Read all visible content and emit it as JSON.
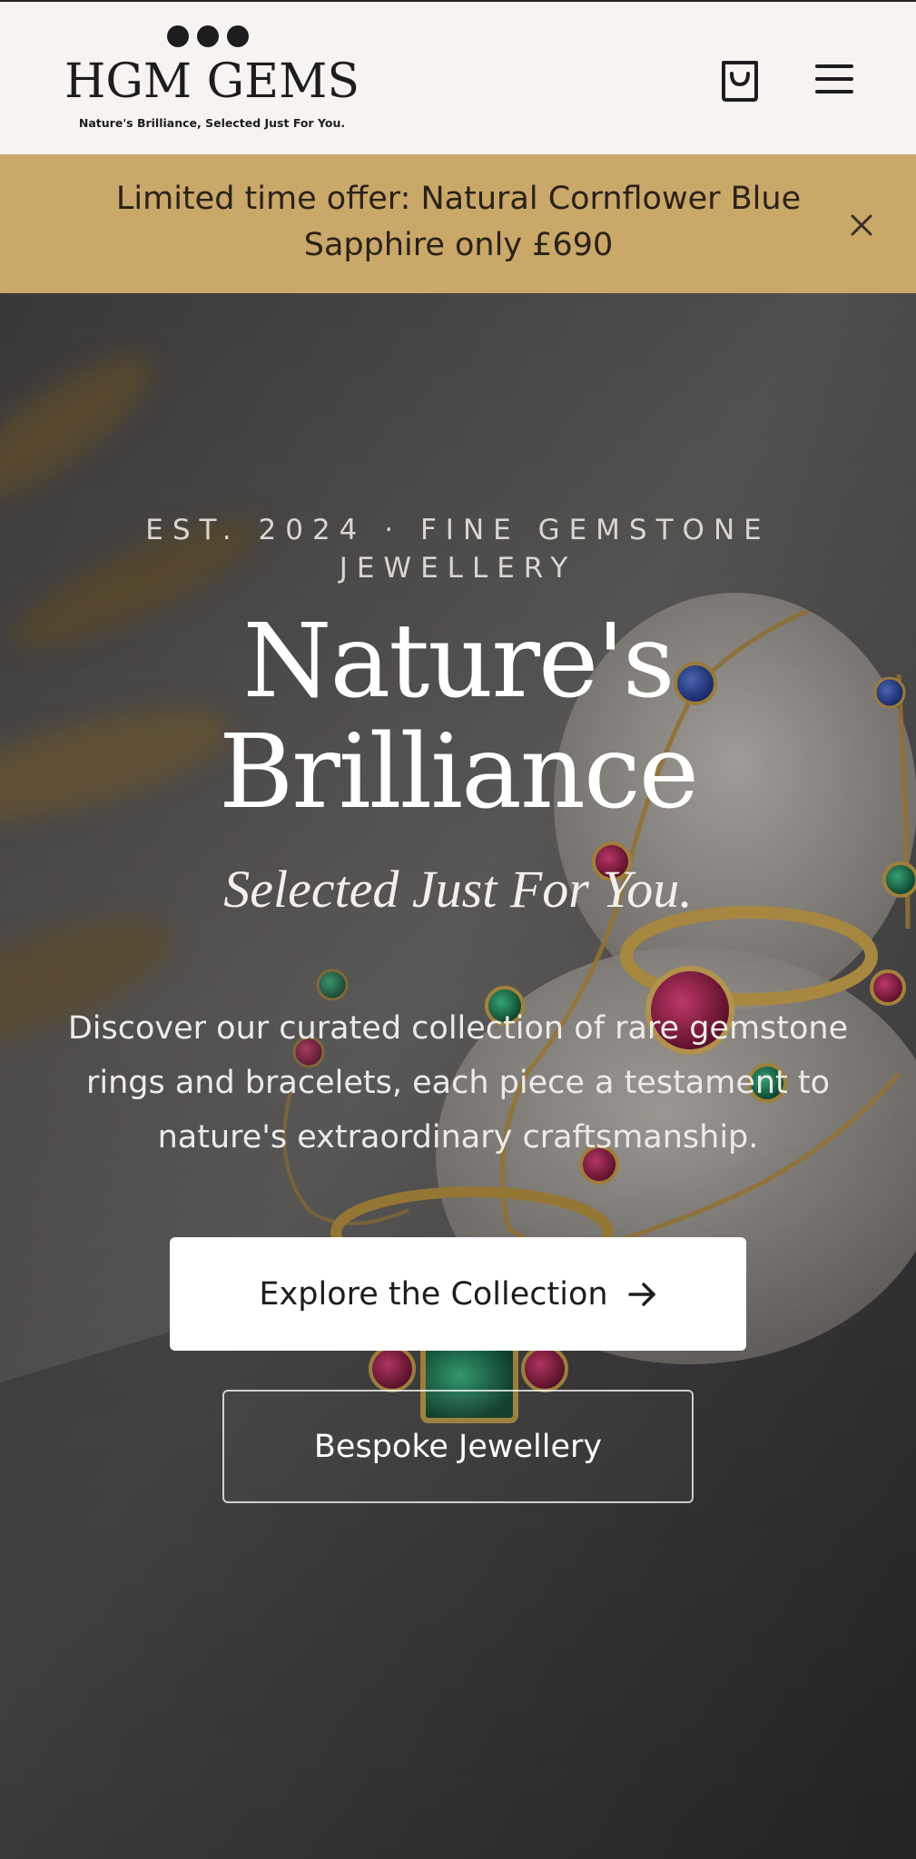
{
  "header": {
    "logo": {
      "wordmark": "HGM GEMS",
      "tagline": "Nature's Brilliance, Selected Just For You."
    },
    "cart_icon": "shopping-bag-icon",
    "menu_icon": "hamburger-menu-icon"
  },
  "announcement": {
    "text": "Limited time offer: Natural Cornflower Blue Sapphire only £690",
    "close_icon": "close-icon"
  },
  "hero": {
    "eyebrow": "EST. 2024 · FINE GEMSTONE JEWELLERY",
    "title": "Nature's Brilliance",
    "subtitle": "Selected Just For You.",
    "description": "Discover our curated collection of rare gemstone rings and bracelets, each piece a testament to nature's extraordinary craftsmanship.",
    "primary_button": "Explore the Collection",
    "primary_button_icon": "arrow-right-icon",
    "secondary_button": "Bespoke Jewellery"
  },
  "colors": {
    "header_bg": "#f7f3f1",
    "announcement_bg": "#c9a86a",
    "ink": "#1d1d1f"
  }
}
